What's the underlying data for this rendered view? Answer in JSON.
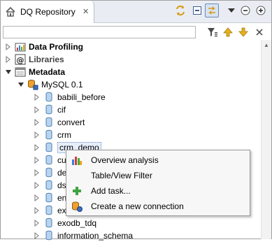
{
  "view": {
    "title": "DQ Repository",
    "close_glyph": "✕"
  },
  "toolbar": {
    "buttons": [
      {
        "icon": "sync-icon"
      },
      {
        "icon": "collapse-all-icon"
      },
      {
        "icon": "link-with-editor-icon"
      },
      {
        "icon": "view-menu-icon"
      },
      {
        "icon": "minimize-icon"
      },
      {
        "icon": "maximize-icon"
      }
    ]
  },
  "filter": {
    "value": "",
    "placeholder": ""
  },
  "tree": {
    "items": [
      {
        "label": "Data Profiling",
        "bold": true
      },
      {
        "label": "Libraries",
        "bold": true
      },
      {
        "label": "Metadata",
        "bold": true
      },
      {
        "label": "MySQL 0.1"
      },
      {
        "label": "babili_before"
      },
      {
        "label": "cif"
      },
      {
        "label": "convert"
      },
      {
        "label": "crm"
      },
      {
        "label": "crm_demo"
      },
      {
        "label": "cu"
      },
      {
        "label": "de"
      },
      {
        "label": "ds"
      },
      {
        "label": "en"
      },
      {
        "label": "ex"
      },
      {
        "label": "exodb_tdq"
      },
      {
        "label": "information_schema"
      }
    ]
  },
  "context_menu": {
    "items": [
      {
        "label": "Overview analysis",
        "icon": "chart-icon"
      },
      {
        "label": "Table/View Filter",
        "icon": ""
      },
      {
        "label": "Add task...",
        "icon": "add-icon"
      },
      {
        "label": "Create a new connection",
        "icon": "new-connection-icon"
      }
    ]
  },
  "colors": {
    "title_bar": "#e9edf3",
    "selection": "#e6eefa",
    "menu_bg": "#f7f7f7"
  }
}
